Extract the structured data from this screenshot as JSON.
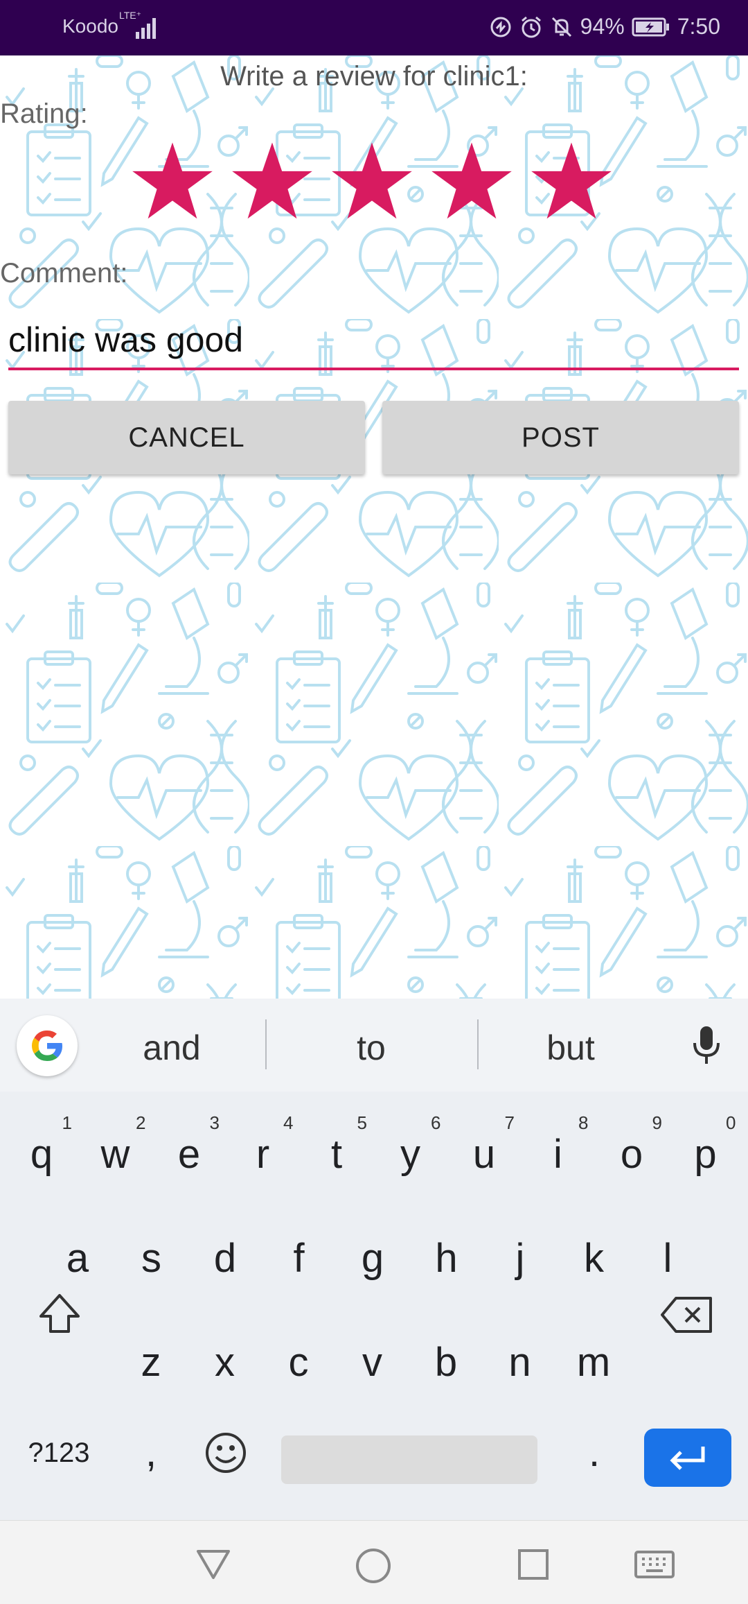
{
  "status_bar": {
    "carrier": "Koodo",
    "network": "LTE⁺",
    "battery_percent": "94%",
    "time": "7:50",
    "icons": [
      "signal-icon",
      "data-saver-icon",
      "alarm-icon",
      "do-not-disturb-icon",
      "battery-icon"
    ]
  },
  "review": {
    "title": "Write a review for clinic1:",
    "rating_label": "Rating:",
    "rating_value": 5,
    "rating_max": 5,
    "comment_label": "Comment:",
    "comment_value": "clinic was good",
    "cancel_label": "CANCEL",
    "post_label": "POST"
  },
  "colors": {
    "status_bar": "#2f0050",
    "accent": "#d81b60",
    "button_bg": "#d6d6d6",
    "pattern": "#b8e0f0",
    "enter_key": "#1a73e8"
  },
  "keyboard": {
    "suggestions": [
      "and",
      "to",
      "but"
    ],
    "row1": [
      {
        "k": "q",
        "s": "1"
      },
      {
        "k": "w",
        "s": "2"
      },
      {
        "k": "e",
        "s": "3"
      },
      {
        "k": "r",
        "s": "4"
      },
      {
        "k": "t",
        "s": "5"
      },
      {
        "k": "y",
        "s": "6"
      },
      {
        "k": "u",
        "s": "7"
      },
      {
        "k": "i",
        "s": "8"
      },
      {
        "k": "o",
        "s": "9"
      },
      {
        "k": "p",
        "s": "0"
      }
    ],
    "row2": [
      "a",
      "s",
      "d",
      "f",
      "g",
      "h",
      "j",
      "k",
      "l"
    ],
    "row3": [
      "z",
      "x",
      "c",
      "v",
      "b",
      "n",
      "m"
    ],
    "symbols_label": "?123",
    "comma": ",",
    "period": "."
  }
}
